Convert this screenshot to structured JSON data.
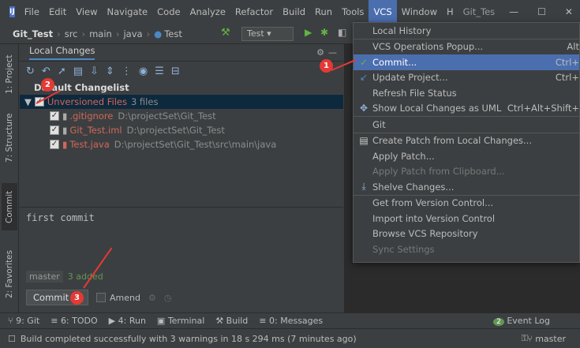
{
  "menubar": {
    "items": [
      "File",
      "Edit",
      "View",
      "Navigate",
      "Code",
      "Analyze",
      "Refactor",
      "Build",
      "Run",
      "Tools",
      "VCS",
      "Window",
      "H",
      "Git_Tes"
    ],
    "active": "VCS",
    "window_controls": [
      "—",
      "☐",
      "✕"
    ]
  },
  "navbar": {
    "project": "Git_Test",
    "crumbs": [
      "src",
      "main",
      "java"
    ],
    "current": "Test",
    "run_config": "Test"
  },
  "left_tabs": [
    "1: Project",
    "7: Structure",
    "Commit",
    "2: Favorites"
  ],
  "panel": {
    "tab": "Local Changes",
    "changelist": "Default Changelist",
    "group": {
      "label": "Unversioned Files",
      "count": "3 files"
    },
    "files": [
      {
        "name": ".gitignore",
        "path": "D:\\projectSet\\Git_Test"
      },
      {
        "name": "Git_Test.iml",
        "path": "D:\\projectSet\\Git_Test"
      },
      {
        "name": "Test.java",
        "path": "D:\\projectSet\\Git_Test\\src\\main\\java"
      }
    ],
    "commit_message": "first commit",
    "branch": "master",
    "added": "3 added",
    "commit_button": "Commit",
    "amend_label": "Amend"
  },
  "vcs_menu": {
    "items": [
      {
        "label": "Local History",
        "shortcut": "",
        "icon": "",
        "state": "normal"
      },
      {
        "sep": true
      },
      {
        "label": "VCS Operations Popup...",
        "shortcut": "Alt",
        "icon": "",
        "state": "normal"
      },
      {
        "label": "Commit...",
        "shortcut": "Ctrl+",
        "icon": "check-icon",
        "state": "highlighted"
      },
      {
        "label": "Update Project...",
        "shortcut": "Ctrl+",
        "icon": "update-arrow-icon",
        "state": "normal"
      },
      {
        "label": "Refresh File Status",
        "shortcut": "",
        "icon": "",
        "state": "normal"
      },
      {
        "label": "Show Local Changes as UML",
        "shortcut": "Ctrl+Alt+Shift+",
        "icon": "uml-icon",
        "state": "normal"
      },
      {
        "sep": true
      },
      {
        "label": "Git",
        "shortcut": "",
        "icon": "",
        "state": "normal"
      },
      {
        "sep": true
      },
      {
        "label": "Create Patch from Local Changes...",
        "shortcut": "",
        "icon": "patch-icon",
        "state": "normal"
      },
      {
        "label": "Apply Patch...",
        "shortcut": "",
        "icon": "",
        "state": "normal"
      },
      {
        "label": "Apply Patch from Clipboard...",
        "shortcut": "",
        "icon": "",
        "state": "disabled"
      },
      {
        "label": "Shelve Changes...",
        "shortcut": "",
        "icon": "shelve-icon",
        "state": "normal"
      },
      {
        "sep": true
      },
      {
        "label": "Get from Version Control...",
        "shortcut": "",
        "icon": "",
        "state": "normal"
      },
      {
        "label": "Import into Version Control",
        "shortcut": "",
        "icon": "",
        "state": "normal"
      },
      {
        "label": "Browse VCS Repository",
        "shortcut": "",
        "icon": "",
        "state": "normal"
      },
      {
        "label": "Sync Settings",
        "shortcut": "",
        "icon": "",
        "state": "disabled"
      }
    ]
  },
  "bottom_tools": [
    "9: Git",
    "6: TODO",
    "4: Run",
    "Terminal",
    "Build",
    "0: Messages",
    "Event Log"
  ],
  "event_log_count": "2",
  "status": {
    "message": "Build completed successfully with 3 warnings in 18 s 294 ms (7 minutes ago)",
    "branch": "master"
  },
  "markers": [
    "1",
    "2",
    "3"
  ],
  "colors": {
    "accent": "#4b6eaf",
    "annotation": "#e53935",
    "selected_row": "#0d293e"
  }
}
